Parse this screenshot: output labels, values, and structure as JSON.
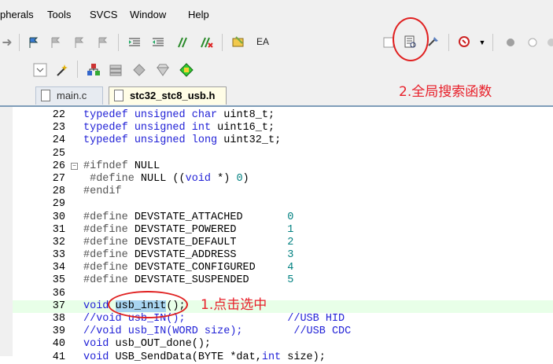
{
  "menu": [
    "pherals",
    "Tools",
    "SVCS",
    "Window",
    "Help"
  ],
  "toolbar": {
    "ea_label": "EA"
  },
  "tabs": [
    {
      "label": "main.c",
      "active": false
    },
    {
      "label": "stc32_stc8_usb.h",
      "active": true
    }
  ],
  "editor": {
    "lines": [
      {
        "n": "22",
        "code": "typedef unsigned char uint8_t;"
      },
      {
        "n": "23",
        "code": "typedef unsigned int uint16_t;"
      },
      {
        "n": "24",
        "code": "typedef unsigned long uint32_t;"
      },
      {
        "n": "25",
        "code": ""
      },
      {
        "n": "26",
        "code": "#ifndef NULL"
      },
      {
        "n": "27",
        "code": " #define NULL ((void *) 0)"
      },
      {
        "n": "28",
        "code": "#endif"
      },
      {
        "n": "29",
        "code": ""
      },
      {
        "n": "30",
        "code": "#define DEVSTATE_ATTACHED       0"
      },
      {
        "n": "31",
        "code": "#define DEVSTATE_POWERED        1"
      },
      {
        "n": "32",
        "code": "#define DEVSTATE_DEFAULT        2"
      },
      {
        "n": "33",
        "code": "#define DEVSTATE_ADDRESS        3"
      },
      {
        "n": "34",
        "code": "#define DEVSTATE_CONFIGURED     4"
      },
      {
        "n": "35",
        "code": "#define DEVSTATE_SUSPENDED      5"
      },
      {
        "n": "36",
        "code": ""
      },
      {
        "n": "37",
        "code": "void usb_init();"
      },
      {
        "n": "38",
        "code": "//void usb_IN();                //USB HID"
      },
      {
        "n": "39",
        "code": "//void usb_IN(WORD size);        //USB CDC"
      },
      {
        "n": "40",
        "code": "void usb_OUT_done();"
      },
      {
        "n": "41",
        "code": "void USB_SendData(BYTE *dat,int size);"
      }
    ]
  },
  "annotations": {
    "step1": "1.点击选中",
    "step2": "2.全局搜索函数"
  },
  "colors": {
    "annotation": "#e8202a",
    "keyword": "#1f1fd6",
    "number": "#008080",
    "selection": "#a8d4f0"
  },
  "icons": [
    "bookmark-icon",
    "indent-icon",
    "comment-icon",
    "find-in-files-icon",
    "debug-icon",
    "build-icon",
    "breakpoint-icon"
  ]
}
